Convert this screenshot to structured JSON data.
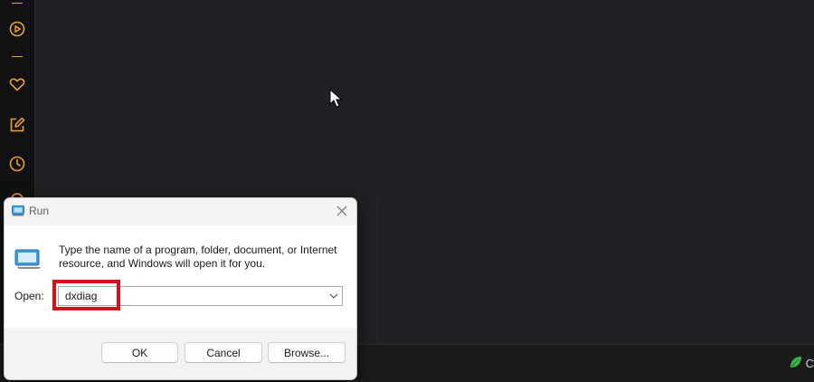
{
  "colors": {
    "sidebar_accent": "#f0a030",
    "highlight": "#d4121c",
    "app_background": "#202124"
  },
  "sidebar": {
    "icons": [
      "play-circle-icon",
      "heart-icon",
      "edit-icon",
      "clock-icon"
    ]
  },
  "run_dialog": {
    "title": "Run",
    "description": "Type the name of a program, folder, document, or Internet resource, and Windows will open it for you.",
    "open_label": "Open:",
    "open_value": "dxdiag",
    "buttons": {
      "ok": "OK",
      "cancel": "Cancel",
      "browse": "Browse..."
    }
  },
  "taskbar": {
    "tray_text": "C"
  }
}
